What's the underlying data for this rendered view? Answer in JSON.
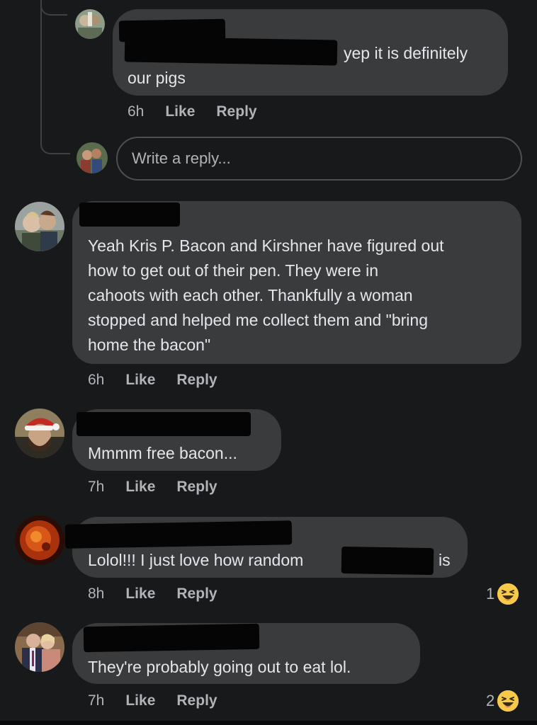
{
  "comments": [
    {
      "id": "reply-nested",
      "text_lines": [
        "yep it is definitely",
        "our pigs"
      ],
      "time": "6h",
      "like_label": "Like",
      "reply_label": "Reply"
    },
    {
      "id": "comment-bacon-story",
      "text_lines": [
        "Yeah Kris P. Bacon and Kirshner have figured out",
        "how to get out of their pen. They were in",
        "cahoots with each other. Thankfully a woman",
        "stopped and helped me collect them and \"bring",
        "home the bacon\""
      ],
      "time": "6h",
      "like_label": "Like",
      "reply_label": "Reply"
    },
    {
      "id": "comment-free-bacon",
      "text_lines": [
        "Mmmm free bacon..."
      ],
      "time": "7h",
      "like_label": "Like",
      "reply_label": "Reply"
    },
    {
      "id": "comment-random",
      "text_before": "Lolol!!! I just love how random",
      "text_after": "is",
      "time": "8h",
      "like_label": "Like",
      "reply_label": "Reply",
      "reaction_count": "1",
      "reaction_type": "haha"
    },
    {
      "id": "comment-eat",
      "text_lines": [
        "They're probably going out to eat lol."
      ],
      "time": "7h",
      "like_label": "Like",
      "reply_label": "Reply",
      "reaction_count": "2",
      "reaction_type": "haha"
    }
  ],
  "reply_box": {
    "placeholder": "Write a reply..."
  },
  "colors": {
    "background": "#18191a",
    "bubble": "#3a3b3c",
    "text_primary": "#e4e6eb",
    "text_secondary": "#b0b3b8",
    "reaction_yellow": "#f7c94b"
  },
  "icons": {
    "reaction": "haha-emoji-icon"
  }
}
